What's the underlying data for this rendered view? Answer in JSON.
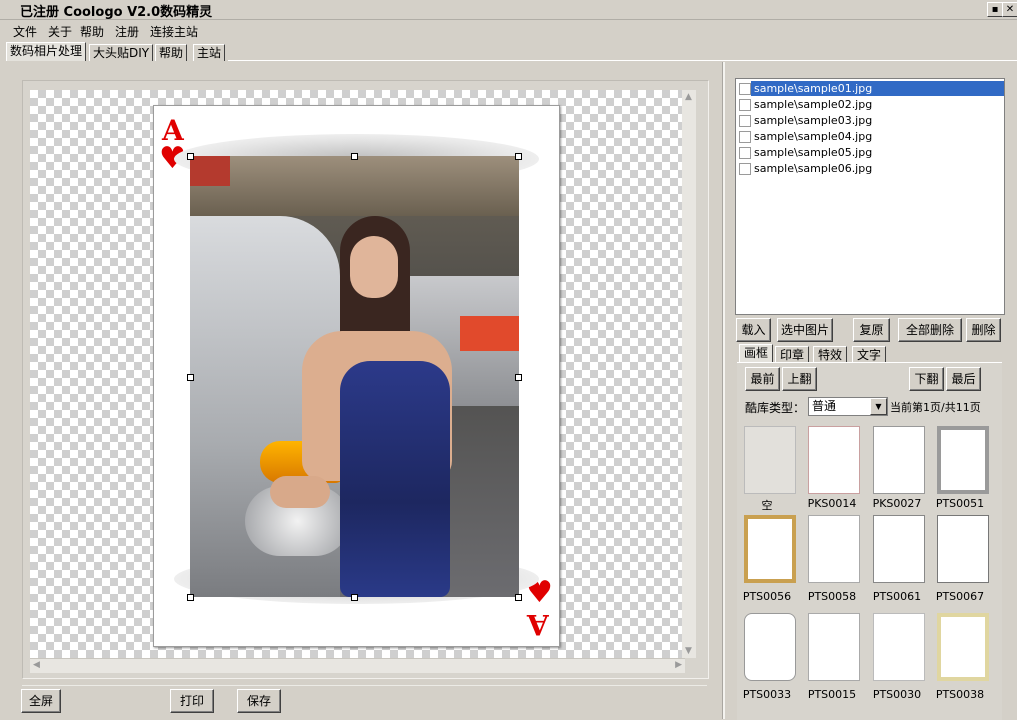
{
  "window": {
    "title": "已注册  Coologo V2.0数码精灵",
    "min_icon": "restore-icon",
    "close_icon": "close-icon"
  },
  "menu": [
    "文件",
    "关于",
    "帮助",
    "注册",
    "连接主站"
  ],
  "tabs": [
    "数码相片处理",
    "大头贴DIY",
    "帮助",
    "主站"
  ],
  "card": {
    "rank": "A",
    "suit": "♥"
  },
  "buttons": {
    "fullscreen": "全屏",
    "print": "打印",
    "save": "保存"
  },
  "files": [
    "sample\\sample01.jpg",
    "sample\\sample02.jpg",
    "sample\\sample03.jpg",
    "sample\\sample04.jpg",
    "sample\\sample05.jpg",
    "sample\\sample06.jpg"
  ],
  "file_actions": [
    "载入",
    "选中图片",
    "复原",
    "全部删除",
    "删除"
  ],
  "right_tabs": [
    "画框",
    "印章",
    "特效",
    "文字"
  ],
  "nav": {
    "first": "最前",
    "prev": "上翻",
    "next": "下翻",
    "last": "最后"
  },
  "library": {
    "label": "酷库类型：",
    "value": "普通",
    "page_info": "当前第1页/共11页"
  },
  "thumbs": [
    "空",
    "PKS0014",
    "PKS0027",
    "PTS0051",
    "PTS0056",
    "PTS0058",
    "PTS0061",
    "PTS0067",
    "PTS0033",
    "PTS0015",
    "PTS0030",
    "PTS0038"
  ]
}
